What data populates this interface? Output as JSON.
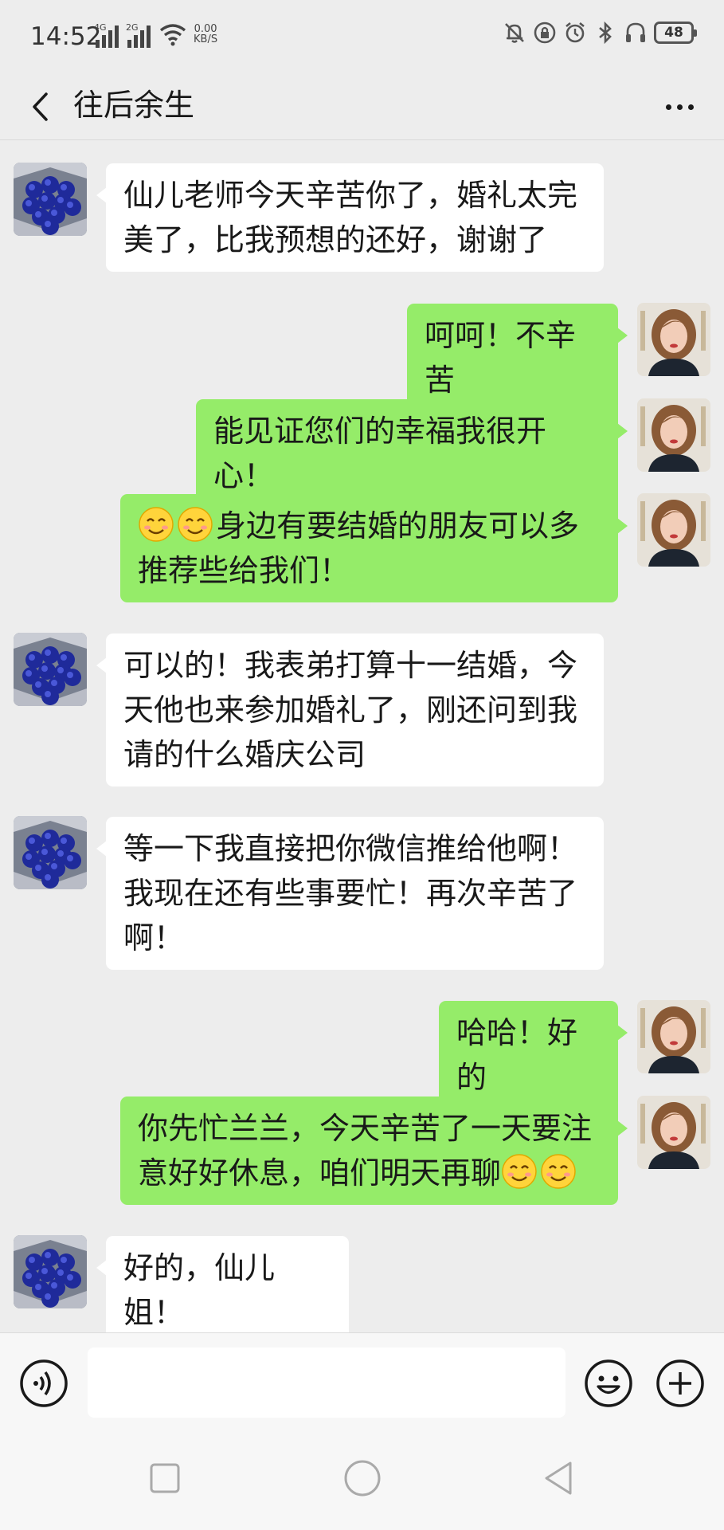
{
  "status_bar": {
    "time": "14:52",
    "net1": "4G",
    "net2": "2G",
    "speed_value": "0.00",
    "speed_unit": "KB/S",
    "battery": "48",
    "icons": [
      "mute-bell-icon",
      "lock-rotation-icon",
      "alarm-icon",
      "bluetooth-icon",
      "headset-icon",
      "battery-icon"
    ]
  },
  "header": {
    "title": "往后余生",
    "back_icon": "chevron-left-icon",
    "more_icon": "more-dots-icon"
  },
  "messages": [
    {
      "side": "left",
      "parts": [
        {
          "text": "仙儿老师今天辛苦你了，婚礼太完美了，比我预想的还好，谢谢了"
        }
      ]
    },
    {
      "side": "right",
      "parts": [
        {
          "text": "呵呵！不辛苦"
        }
      ]
    },
    {
      "side": "right",
      "parts": [
        {
          "text": "能见证您们的幸福我很开心！"
        }
      ]
    },
    {
      "side": "right",
      "parts": [
        {
          "emoji": "smile-emoji"
        },
        {
          "emoji": "smile-emoji"
        },
        {
          "text": "身边有要结婚的朋友可以多推荐些给我们！"
        }
      ]
    },
    {
      "side": "left",
      "parts": [
        {
          "text": "可以的！我表弟打算十一结婚，今天他也来参加婚礼了，刚还问到我请的什么婚庆公司"
        }
      ]
    },
    {
      "side": "left",
      "parts": [
        {
          "text": "等一下我直接把你微信推给他啊！我现在还有些事要忙！再次辛苦了啊！"
        }
      ]
    },
    {
      "side": "right",
      "parts": [
        {
          "text": "哈哈！好的"
        }
      ]
    },
    {
      "side": "right",
      "parts": [
        {
          "text": "你先忙兰兰，今天辛苦了一天要注意好好休息，咱们明天再聊"
        },
        {
          "emoji": "smile-emoji"
        },
        {
          "emoji": "smile-emoji"
        }
      ]
    },
    {
      "side": "left",
      "parts": [
        {
          "text": "好的，仙儿姐！"
        }
      ]
    }
  ],
  "input_bar": {
    "voice_icon": "voice-icon",
    "input_value": "",
    "emoji_icon": "emoji-face-icon",
    "plus_icon": "plus-circle-icon"
  },
  "nav_bar": {
    "icons": [
      "recent-apps-icon",
      "home-icon",
      "back-triangle-icon"
    ]
  },
  "colors": {
    "background": "#ededed",
    "sent_bubble": "#95ec69",
    "received_bubble": "#ffffff",
    "text": "#191919"
  }
}
